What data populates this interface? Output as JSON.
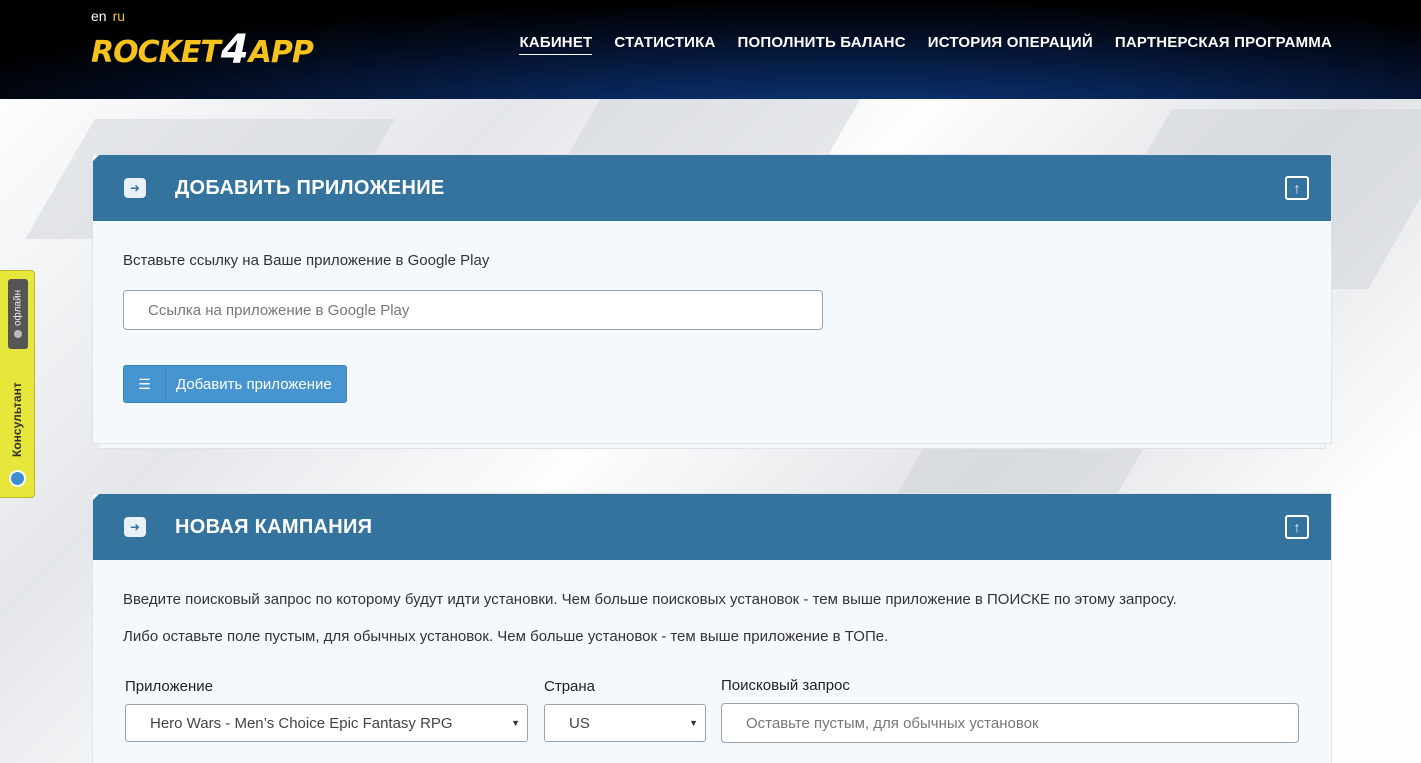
{
  "header": {
    "lang_en": "en",
    "lang_ru": "ru",
    "logo_left": "ROCKET",
    "logo_four": "4",
    "logo_right": "APP",
    "nav": [
      {
        "label": "КАБИНЕТ",
        "active": true
      },
      {
        "label": "СТАТИСТИКА",
        "active": false
      },
      {
        "label": "ПОПОЛНИТЬ БАЛАНС",
        "active": false
      },
      {
        "label": "ИСТОРИЯ ОПЕРАЦИЙ",
        "active": false
      },
      {
        "label": "ПАРТНЕРСКАЯ ПРОГРАММА",
        "active": false
      }
    ]
  },
  "consultant": {
    "label": "Консультант",
    "status": "офлайн"
  },
  "add_app_panel": {
    "title": "ДОБАВИТЬ ПРИЛОЖЕНИЕ",
    "instruction": "Вставьте ссылку на Ваше приложение в Google Play",
    "link_placeholder": "Ссылка на приложение в Google Play",
    "link_value": "",
    "button_label": "Добавить приложение"
  },
  "campaign_panel": {
    "title": "НОВАЯ КАМПАНИЯ",
    "text1": "Введите поисковый запрос по которому будут идти установки. Чем больше поисковых установок - тем выше приложение в ПОИСКЕ по этому запросу.",
    "text2": "Либо оставьте поле пустым, для обычных установок. Чем больше установок - тем выше приложение в ТОПе.",
    "app_label": "Приложение",
    "app_selected": "Hero Wars - Men’s Choice Epic Fantasy RPG",
    "country_label": "Страна",
    "country_selected": "US",
    "query_label": "Поисковый запрос",
    "query_placeholder": "Оставьте пустым, для обычных установок",
    "query_value": ""
  },
  "colors": {
    "header_bg": "#030b1e",
    "panel_header": "#35739f",
    "button": "#4795d0",
    "logo_yellow": "#f7c21c",
    "consultant_bg": "#e7e63a"
  }
}
